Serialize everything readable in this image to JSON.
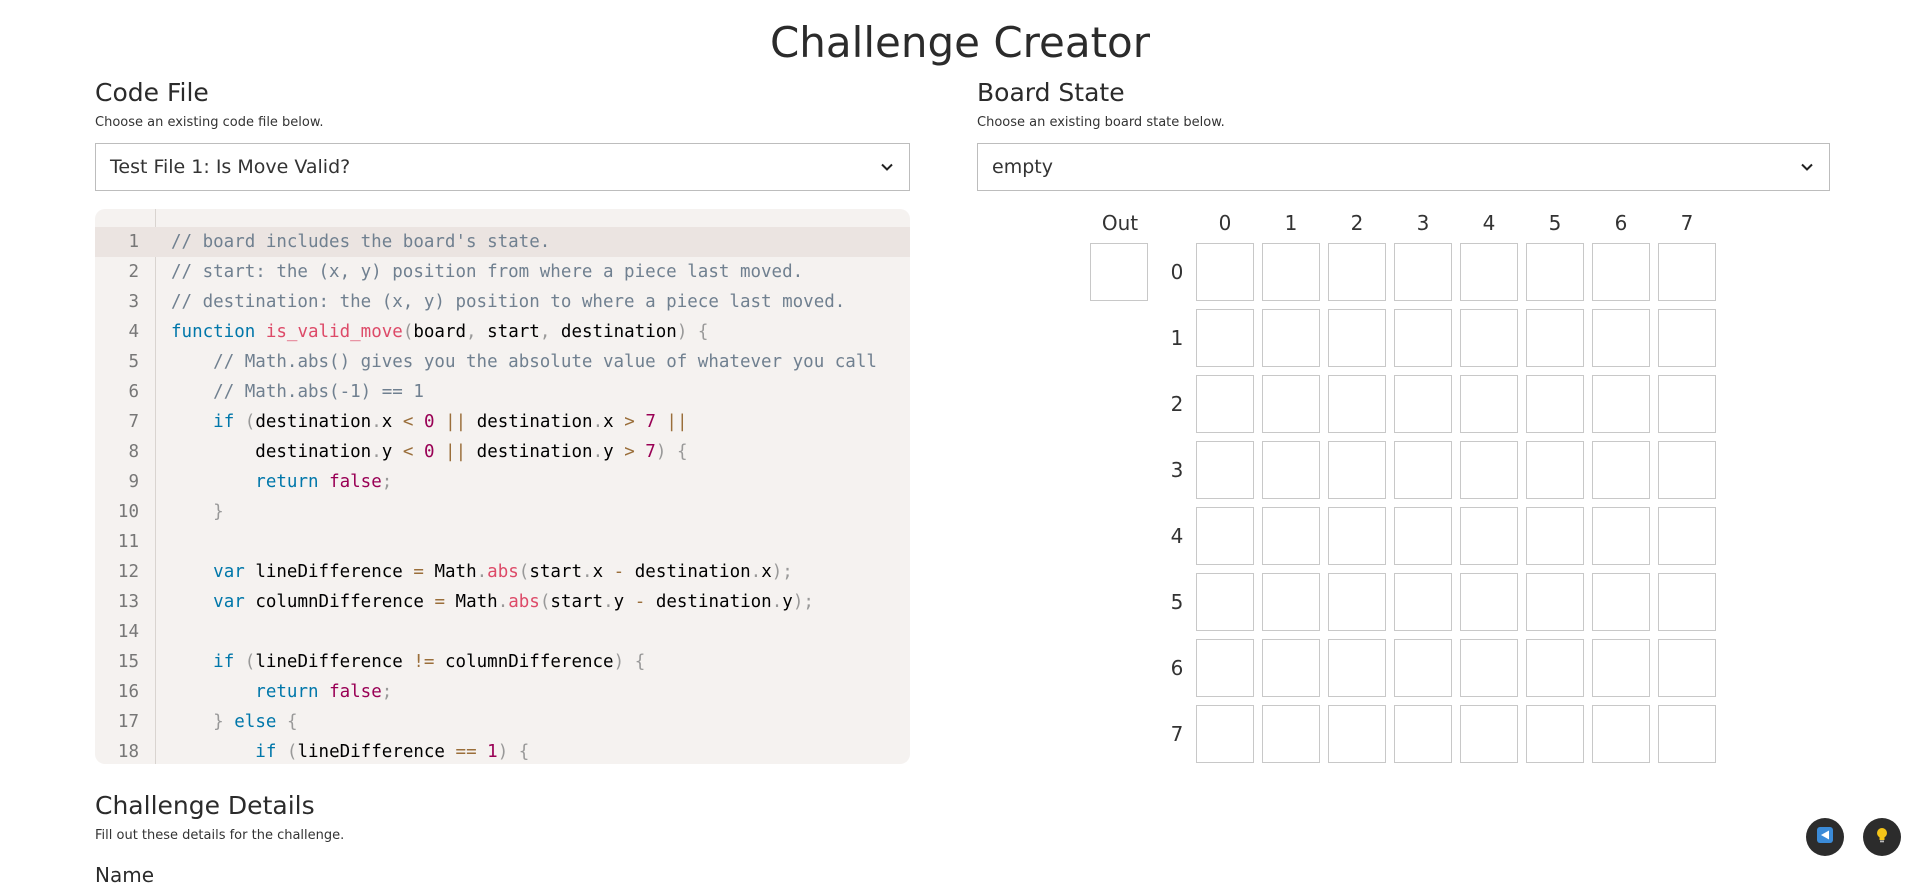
{
  "page": {
    "title": "Challenge Creator"
  },
  "code_file": {
    "title": "Code File",
    "description": "Choose an existing code file below.",
    "selected": "Test File 1: Is Move Valid?",
    "lines": [
      "// board includes the board's state.",
      "// start: the (x, y) position from where a piece last moved.",
      "// destination: the (x, y) position to where a piece last moved.",
      "function is_valid_move(board, start, destination) {",
      "    // Math.abs() gives you the absolute value of whatever you call",
      "    // Math.abs(-1) == 1",
      "    if (destination.x < 0 || destination.x > 7 ||",
      "        destination.y < 0 || destination.y > 7) {",
      "        return false;",
      "    }",
      "",
      "    var lineDifference = Math.abs(start.x - destination.x);",
      "    var columnDifference = Math.abs(start.y - destination.y);",
      "",
      "    if (lineDifference != columnDifference) {",
      "        return false;",
      "    } else {",
      "        if (lineDifference == 1) {"
    ]
  },
  "board_state": {
    "title": "Board State",
    "description": "Choose an existing board state below.",
    "selected": "empty",
    "out_label": "Out",
    "columns": [
      "0",
      "1",
      "2",
      "3",
      "4",
      "5",
      "6",
      "7"
    ],
    "rows": [
      "0",
      "1",
      "2",
      "3",
      "4",
      "5",
      "6",
      "7"
    ]
  },
  "challenge_details": {
    "title": "Challenge Details",
    "description": "Fill out these details for the challenge.",
    "name_label": "Name"
  },
  "icons": {
    "select_chevron": "chevron-down-icon",
    "fab_left": "send-icon",
    "fab_right": "lightbulb-icon"
  }
}
